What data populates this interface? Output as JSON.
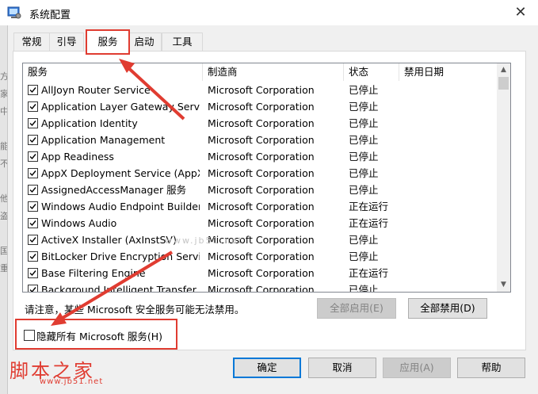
{
  "window": {
    "title": "系统配置",
    "close_glyph": "✕"
  },
  "frame_left_chars": [
    "方",
    "家",
    "中",
    "",
    "能",
    "不",
    "",
    "他",
    "盗",
    "",
    "国",
    "重"
  ],
  "tabs": [
    {
      "label": "常规",
      "selected": false
    },
    {
      "label": "引导",
      "selected": false
    },
    {
      "label": "服务",
      "selected": true
    },
    {
      "label": "启动",
      "selected": false
    },
    {
      "label": "工具",
      "selected": false
    }
  ],
  "list": {
    "headers": {
      "service": "服务",
      "manufacturer": "制造商",
      "status": "状态",
      "disabled_date": "禁用日期"
    },
    "rows": [
      {
        "name": "AllJoyn Router Service",
        "maker": "Microsoft Corporation",
        "status": "已停止",
        "checked": true
      },
      {
        "name": "Application Layer Gateway Service",
        "maker": "Microsoft Corporation",
        "status": "已停止",
        "checked": true
      },
      {
        "name": "Application Identity",
        "maker": "Microsoft Corporation",
        "status": "已停止",
        "checked": true
      },
      {
        "name": "Application Management",
        "maker": "Microsoft Corporation",
        "status": "已停止",
        "checked": true
      },
      {
        "name": "App Readiness",
        "maker": "Microsoft Corporation",
        "status": "已停止",
        "checked": true
      },
      {
        "name": "AppX Deployment Service (AppX...",
        "maker": "Microsoft Corporation",
        "status": "已停止",
        "checked": true
      },
      {
        "name": "AssignedAccessManager 服务",
        "maker": "Microsoft Corporation",
        "status": "已停止",
        "checked": true
      },
      {
        "name": "Windows Audio Endpoint Builder",
        "maker": "Microsoft Corporation",
        "status": "正在运行",
        "checked": true
      },
      {
        "name": "Windows Audio",
        "maker": "Microsoft Corporation",
        "status": "正在运行",
        "checked": true
      },
      {
        "name": "ActiveX Installer (AxInstSV)",
        "maker": "Microsoft Corporation",
        "status": "已停止",
        "checked": true
      },
      {
        "name": "BitLocker Drive Encryption Service",
        "maker": "Microsoft Corporation",
        "status": "已停止",
        "checked": true
      },
      {
        "name": "Base Filtering Engine",
        "maker": "Microsoft Corporation",
        "status": "正在运行",
        "checked": true
      },
      {
        "name": "Background Intelligent Transfer ...",
        "maker": "Microsoft Corporation",
        "status": "已停止",
        "checked": true
      }
    ]
  },
  "notice": "请注意，某些 Microsoft 安全服务可能无法禁用。",
  "buttons": {
    "enable_all": "全部启用(E)",
    "disable_all": "全部禁用(D)",
    "ok": "确定",
    "cancel": "取消",
    "apply": "应用(A)",
    "help": "帮助"
  },
  "hide_ms": {
    "label": "隐藏所有 Microsoft 服务(H)",
    "checked": false
  },
  "watermark": {
    "title": "脚本之家",
    "url": "www.jb51.net",
    "center": "www.jb51.net"
  },
  "colors": {
    "highlight": "#e03c31",
    "focus": "#0078d7"
  }
}
